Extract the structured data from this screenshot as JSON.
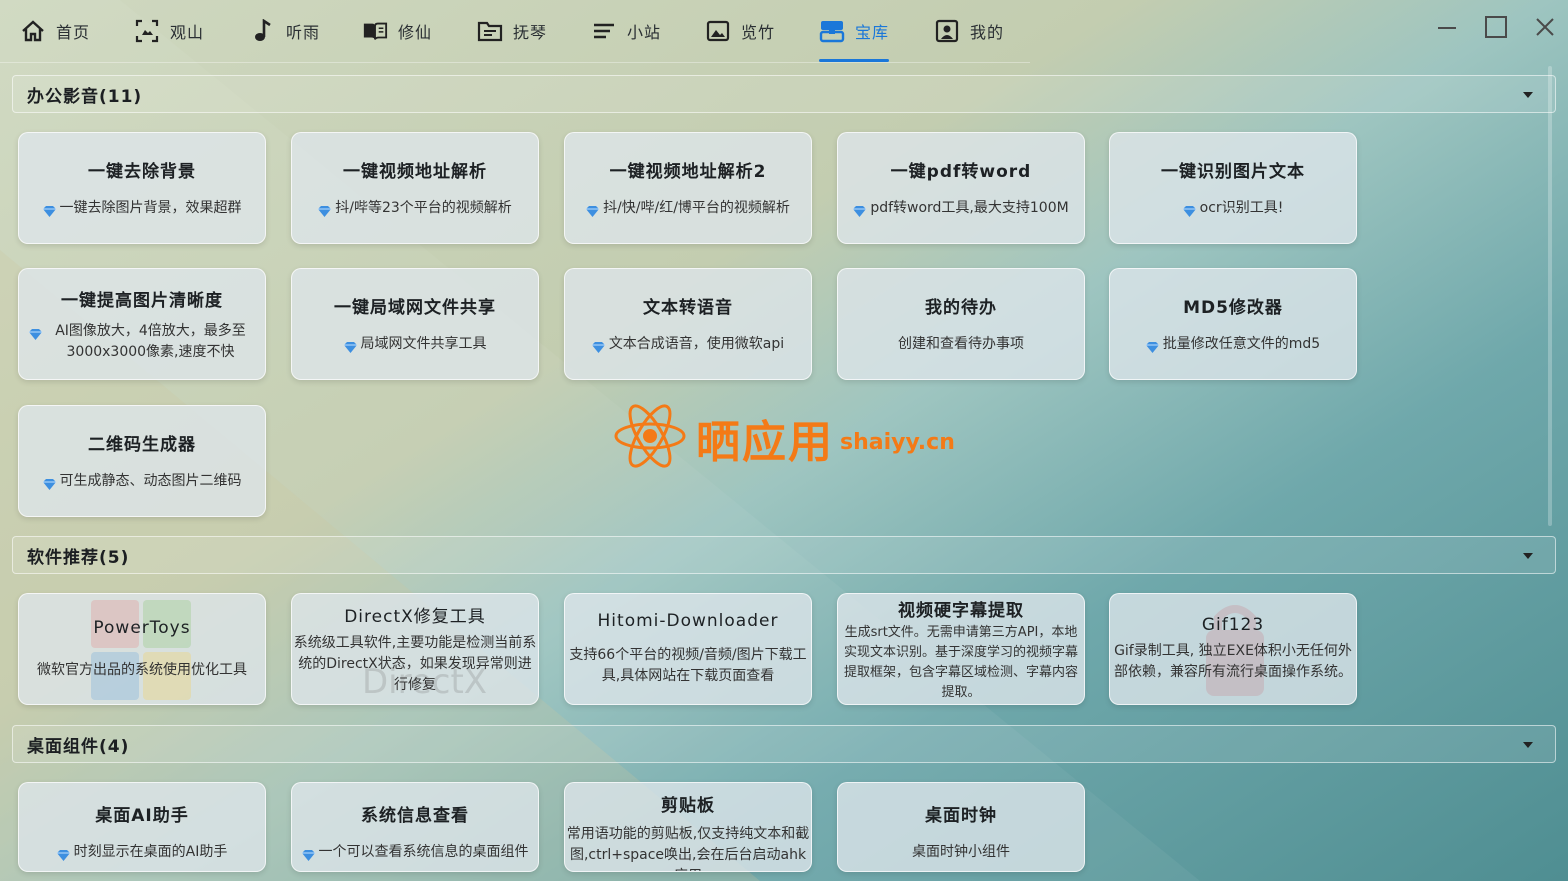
{
  "nav": {
    "tabs": [
      {
        "label": "首页",
        "icon": "home-icon"
      },
      {
        "label": "观山",
        "icon": "frame-icon"
      },
      {
        "label": "听雨",
        "icon": "music-note-icon"
      },
      {
        "label": "修仙",
        "icon": "book-icon"
      },
      {
        "label": "抚琴",
        "icon": "folder-icon"
      },
      {
        "label": "小站",
        "icon": "menu-lines-icon"
      },
      {
        "label": "览竹",
        "icon": "image-icon"
      },
      {
        "label": "宝库",
        "icon": "treasure-icon"
      },
      {
        "label": "我的",
        "icon": "user-card-icon"
      }
    ],
    "active_tab": "宝库",
    "active_color": "#1a77d9"
  },
  "window_controls": [
    "minimize-icon",
    "maximize-icon",
    "close-icon"
  ],
  "sections": [
    {
      "title": "办公影音(11)",
      "cards": [
        {
          "title": "一键去除背景",
          "desc": "一键去除图片背景，效果超群",
          "gem": true
        },
        {
          "title": "一键视频地址解析",
          "desc": "抖/哔等23个平台的视频解析",
          "gem": true
        },
        {
          "title": "一键视频地址解析2",
          "desc": "抖/快/哔/红/博平台的视频解析",
          "gem": true
        },
        {
          "title": "一键pdf转word",
          "desc": "pdf转word工具,最大支持100M",
          "gem": true
        },
        {
          "title": "一键识别图片文本",
          "desc": "ocr识别工具!",
          "gem": true
        },
        {
          "title": "一键提高图片清晰度",
          "desc": "AI图像放大，4倍放大，最多至3000x3000像素,速度不快",
          "gem": true
        },
        {
          "title": "一键局域网文件共享",
          "desc": "局域网文件共享工具",
          "gem": true
        },
        {
          "title": "文本转语音",
          "desc": "文本合成语音，使用微软api",
          "gem": true
        },
        {
          "title": "我的待办",
          "desc": "创建和查看待办事项",
          "gem": false
        },
        {
          "title": "MD5修改器",
          "desc": "批量修改任意文件的md5",
          "gem": true
        },
        {
          "title": "二维码生成器",
          "desc": "可生成静态、动态图片二维码",
          "gem": true
        }
      ]
    },
    {
      "title": "软件推荐(5)",
      "cards": [
        {
          "title": "PowerToys",
          "desc": "微软官方出品的系统使用优化工具",
          "gem": false
        },
        {
          "title": "DirectX修复工具",
          "desc": "系统级工具软件,主要功能是检测当前系统的DirectX状态，如果发现异常则进行修复",
          "gem": false
        },
        {
          "title": "Hitomi-Downloader",
          "desc": "支持66个平台的视频/音频/图片下载工具,具体网站在下载页面查看",
          "gem": false
        },
        {
          "title": "视频硬字幕提取",
          "desc": "生成srt文件。无需申请第三方API，本地实现文本识别。基于深度学习的视频字幕提取框架，包含字幕区域检测、字幕内容提取。",
          "gem": false
        },
        {
          "title": "Gif123",
          "desc": "Gif录制工具, 独立EXE体积小无任何外部依赖，兼容所有流行桌面操作系统。",
          "gem": false
        }
      ]
    },
    {
      "title": "桌面组件(4)",
      "cards": [
        {
          "title": "桌面AI助手",
          "desc": "时刻显示在桌面的AI助手",
          "gem": true
        },
        {
          "title": "系统信息查看",
          "desc": "一个可以查看系统信息的桌面组件",
          "gem": true
        },
        {
          "title": "剪贴板",
          "desc": "常用语功能的剪贴板,仅支持纯文本和截图,ctrl+space唤出,会在后台启动ahk应用",
          "gem": false
        },
        {
          "title": "桌面时钟",
          "desc": "桌面时钟小组件",
          "gem": false
        }
      ]
    }
  ],
  "watermark": {
    "cn": "晒应用",
    "en": "shaiyy.cn",
    "color": "#f47a16"
  }
}
